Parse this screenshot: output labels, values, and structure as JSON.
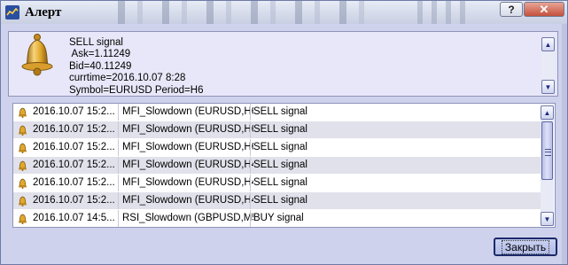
{
  "window": {
    "title": "Алерт",
    "help_label": "?",
    "close_icon": "close-icon",
    "colors": {
      "frame": "#cfd2ec",
      "panel": "#e7e7f9",
      "alt_row": "#e1e1eb",
      "button": "#b2bbe6"
    }
  },
  "message": {
    "icon": "bell-icon",
    "lines": [
      "SELL signal",
      " Ask=1.11249",
      "Bid=40.11249",
      "currtime=2016.10.07 8:28",
      "Symbol=EURUSD Period=H6"
    ]
  },
  "alerts": {
    "rows": [
      {
        "time": "2016.10.07 15:2...",
        "name": "MFI_Slowdown (EURUSD,H6)",
        "message": "SELL signal"
      },
      {
        "time": "2016.10.07 15:2...",
        "name": "MFI_Slowdown (EURUSD,H6)",
        "message": "SELL signal"
      },
      {
        "time": "2016.10.07 15:2...",
        "name": "MFI_Slowdown (EURUSD,H6)",
        "message": "SELL signal"
      },
      {
        "time": "2016.10.07 15:2...",
        "name": "MFI_Slowdown (EURUSD,H4)",
        "message": "SELL signal"
      },
      {
        "time": "2016.10.07 15:2...",
        "name": "MFI_Slowdown (EURUSD,H4)",
        "message": "SELL signal"
      },
      {
        "time": "2016.10.07 15:2...",
        "name": "MFI_Slowdown (EURUSD,H4)",
        "message": "SELL signal"
      },
      {
        "time": "2016.10.07 14:5...",
        "name": "RSI_Slowdown (GBPUSD,M5)",
        "message": "BUY signal"
      }
    ]
  },
  "footer": {
    "close_label": "Закрыть"
  }
}
